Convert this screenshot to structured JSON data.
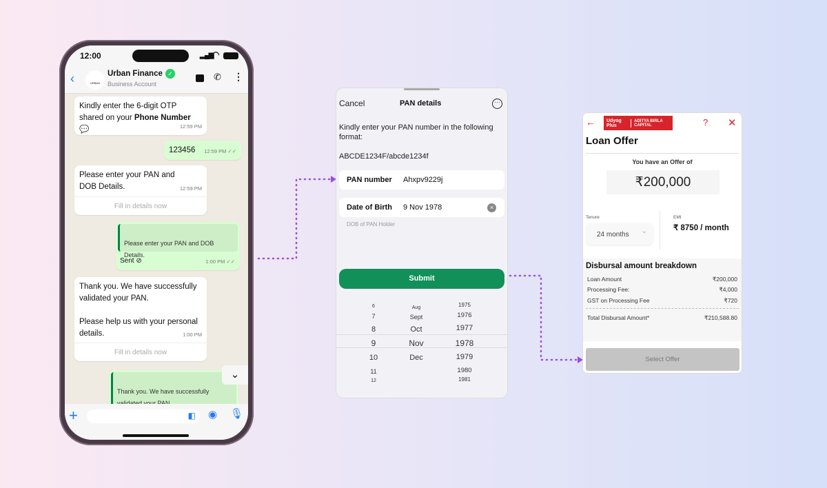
{
  "colors": {
    "brand_green": "#11905a",
    "whatsapp_bubble_out": "#d9fdd3",
    "connector": "#9b4de0",
    "loan_red": "#d8232a"
  },
  "phone": {
    "status_time": "12:00",
    "chat": {
      "name": "Urban Finance",
      "subtitle": "Business Account",
      "avatar_text": "URBAN",
      "verified": true
    },
    "messages": [
      {
        "dir": "in",
        "text_pre": "Kindly enter the 6-digit OTP shared on your ",
        "text_bold": "Phone Number",
        "time": "12:59 PM"
      },
      {
        "dir": "out",
        "text": "123456",
        "time": "12:59 PM"
      },
      {
        "dir": "in",
        "text": "Please enter your PAN and DOB Details.",
        "time": "12:59 PM",
        "action": "Fill in details now"
      },
      {
        "dir": "out",
        "quote": "Please enter your PAN and DOB Details.",
        "text": "Sent",
        "time": "1:00 PM"
      },
      {
        "dir": "in",
        "text1": "Thank you. We have successfully validated your PAN.",
        "text2": "Please help us with your personal details.",
        "time": "1:00 PM",
        "action": "Fill in details now"
      },
      {
        "dir": "out",
        "quote": "Thank you. We have successfully validated your PAN."
      }
    ]
  },
  "pan_form": {
    "cancel": "Cancel",
    "title": "PAN details",
    "instruction": "Kindly enter your PAN number in the following format:",
    "format": "ABCDE1234F/abcde1234f",
    "pan_label": "PAN number",
    "pan_value": "Ahxpv9229j",
    "dob_label": "Date of Birth",
    "dob_value": "9 Nov 1978",
    "dob_hint": "DOB of PAN Holder",
    "submit": "Submit",
    "picker": {
      "days": [
        "6",
        "7",
        "8",
        "9",
        "10",
        "11",
        "12"
      ],
      "months": [
        "Aug",
        "Sept",
        "Oct",
        "Nov",
        "Dec"
      ],
      "years": [
        "1975",
        "1976",
        "1977",
        "1978",
        "1979",
        "1980",
        "1981"
      ],
      "selected": {
        "day": "9",
        "month": "Nov",
        "year": "1978"
      }
    }
  },
  "loan": {
    "logo_left": "Udyog Plus",
    "logo_right": "ADITYA BIRLA CAPITAL",
    "help": "?",
    "title": "Loan Offer",
    "offer_label": "You have an Offer of",
    "offer_amount": "₹200,000",
    "tenure_label": "Tenure",
    "tenure_value": "24 months",
    "emi_label": "EMI",
    "emi_value": "₹ 8750 / month",
    "breakdown_title": "Disbursal amount breakdown",
    "rows": [
      {
        "label": "Loan Amount",
        "value": "₹200,000"
      },
      {
        "label": "Processing Fee:",
        "value": "₹4,000"
      },
      {
        "label": "GST on Processing Fee",
        "value": "₹720"
      }
    ],
    "total": {
      "label": "Total Disbursal Amount*",
      "value": "₹210,588.80"
    },
    "cta": "Select Offer"
  }
}
